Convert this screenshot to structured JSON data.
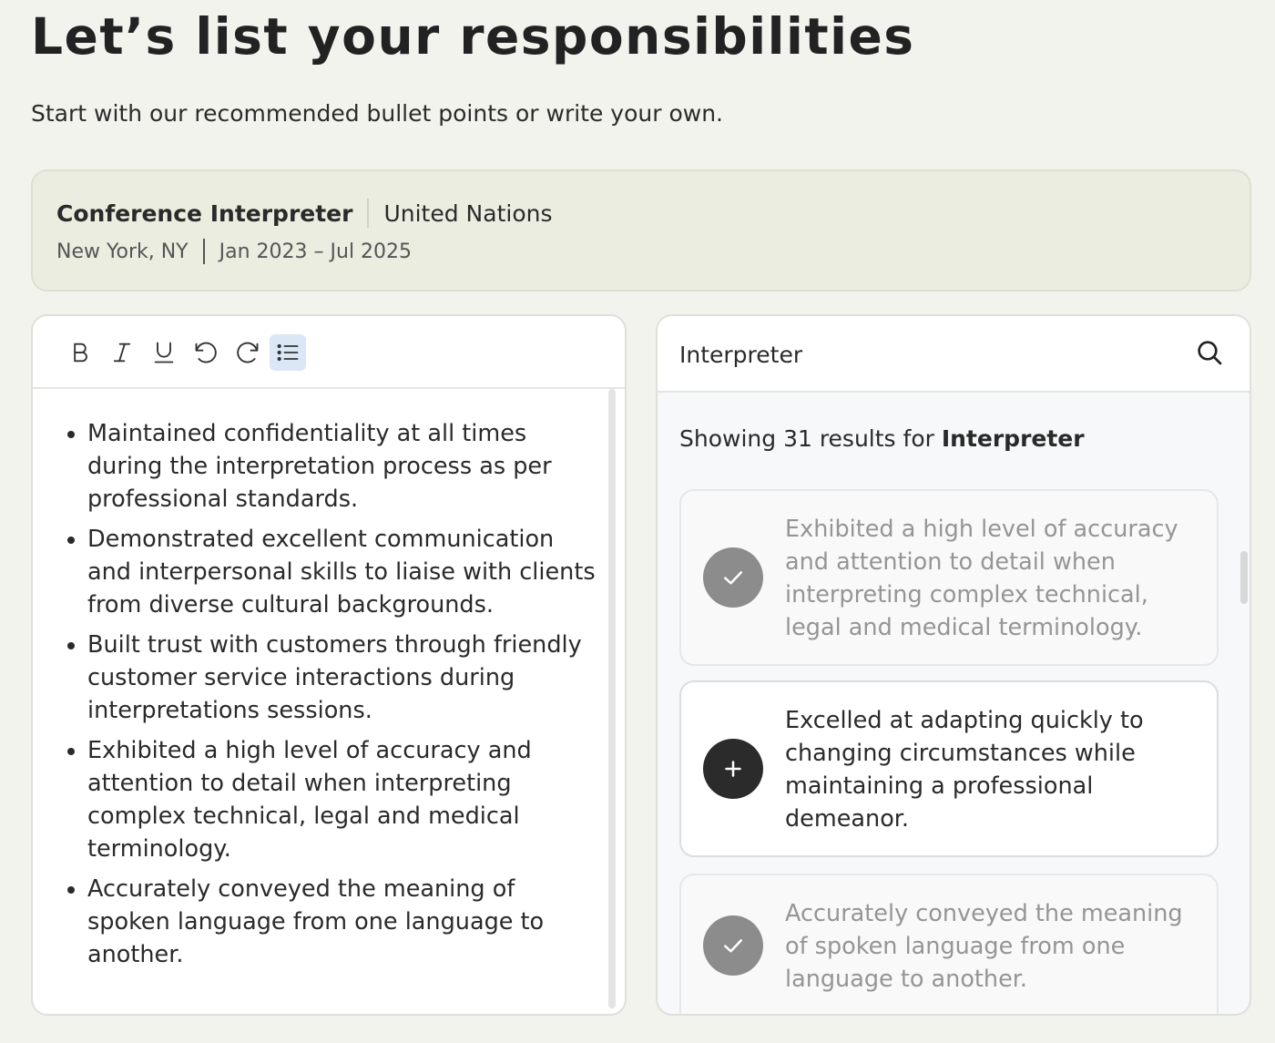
{
  "heading": "Let’s list your responsibilities",
  "subheading": "Start with our recommended bullet points or write your own.",
  "job": {
    "title": "Conference Interpreter",
    "company": "United Nations",
    "location": "New York, NY",
    "dates": "Jan 2023 – Jul 2025"
  },
  "toolbar": {
    "icons": [
      "bold-icon",
      "italic-icon",
      "underline-icon",
      "undo-icon",
      "redo-icon",
      "bullet-list-icon"
    ],
    "active": "bullet-list-icon"
  },
  "editor": {
    "bullets": [
      "Maintained confidentiality at all times during the interpretation process as per professional standards.",
      "Demonstrated excellent communication and interpersonal skills to liaise with clients from diverse cultural backgrounds.",
      "Built trust with customers through friendly customer service interactions during interpretations sessions.",
      "Exhibited a high level of accuracy and attention to detail when interpreting complex technical, legal and medical terminology.",
      "Accurately conveyed the meaning of spoken language from one language to another."
    ]
  },
  "search": {
    "value": "Interpreter",
    "results_prefix": "Showing 31 results for ",
    "results_query": "Interpreter",
    "suggestions": [
      {
        "text": "Exhibited a high level of accuracy and attention to detail when interpreting complex technical, legal and medical terminology.",
        "state": "added",
        "icon": "check-icon"
      },
      {
        "text": "Excelled at adapting quickly to changing circumstances while maintaining a professional demeanor.",
        "state": "available",
        "icon": "plus-icon"
      },
      {
        "text": "Accurately conveyed the meaning of spoken language from one language to another.",
        "state": "added",
        "icon": "check-icon"
      }
    ]
  },
  "colors": {
    "background": "#f2f3ec",
    "job_card": "#ebede0",
    "active_toolbar": "#dbe6f7",
    "added_icon": "#8c8c8c",
    "add_icon": "#2b2b2b"
  }
}
